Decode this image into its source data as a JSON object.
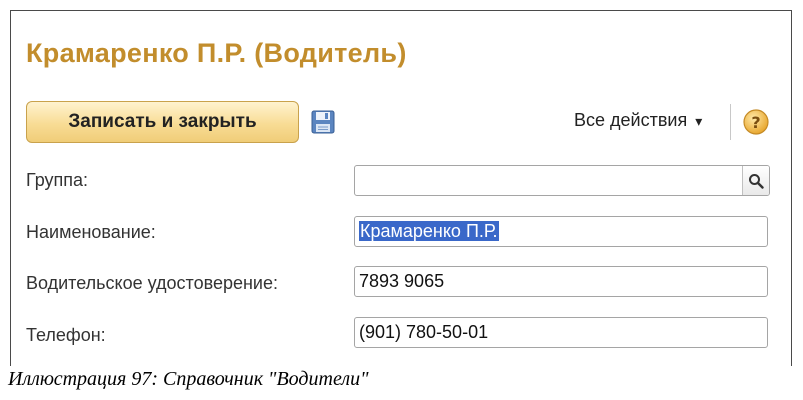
{
  "window": {
    "title": "Крамаренко П.Р. (Водитель)"
  },
  "toolbar": {
    "save_close_label": "Записать и закрыть",
    "save_icon": "floppy-disk-icon",
    "all_actions_label": "Все действия",
    "all_actions_arrow": "▾",
    "help_icon": "question-mark-icon"
  },
  "form": {
    "group": {
      "label": "Группа:",
      "value": "",
      "picker_icon": "search-icon"
    },
    "name": {
      "label": "Наименование:",
      "value": "Крамаренко П.Р."
    },
    "license": {
      "label": "Водительское удостоверение:",
      "value": "7893 9065"
    },
    "phone": {
      "label": "Телефон:",
      "value": "(901) 780-50-01"
    }
  },
  "caption": "Иллюстрация 97: Справочник \"Водители\"",
  "colors": {
    "title": "#c28d2c",
    "selection": "#3a68c9",
    "button": "#f8dc95"
  }
}
